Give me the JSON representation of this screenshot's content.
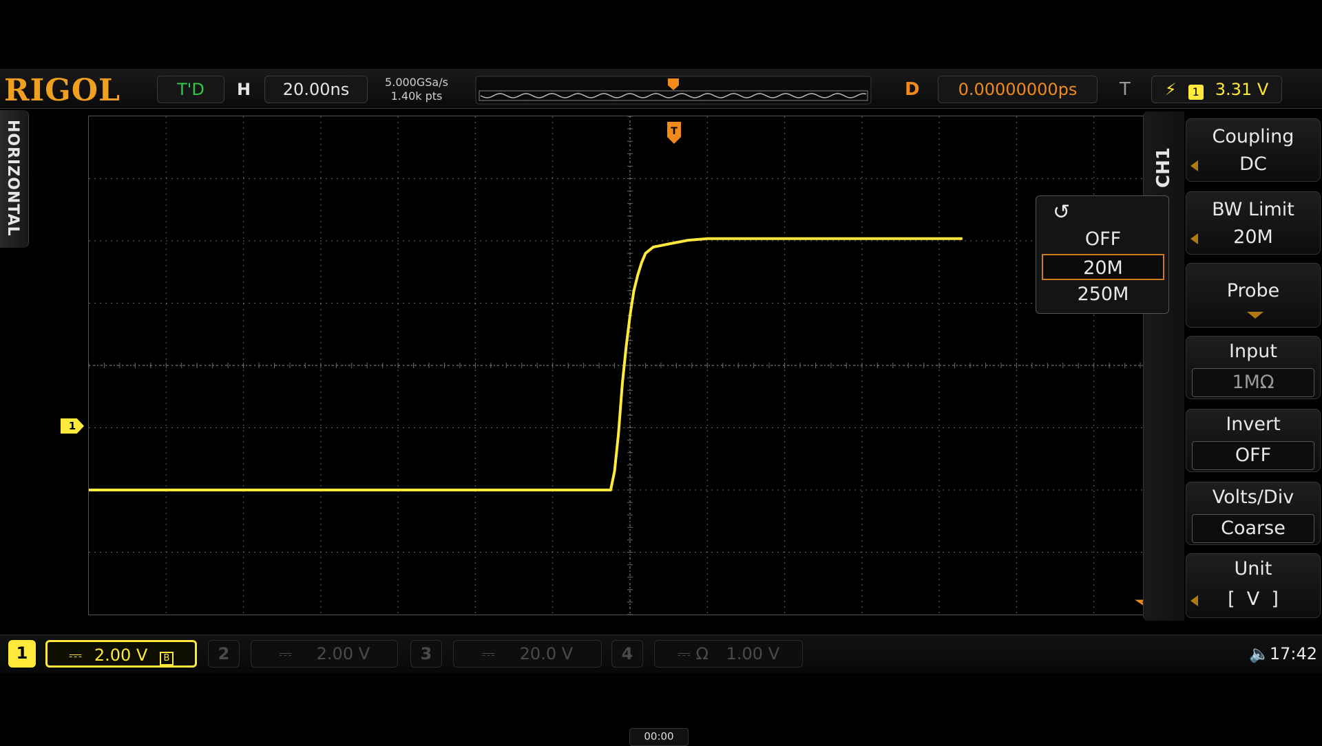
{
  "brand": "RIGOL",
  "status": {
    "trigger_status": "T'D",
    "horizontal_label": "H",
    "timebase": "20.00ns",
    "sample_rate": "5.000GSa/s",
    "memory_depth": "1.40k pts",
    "delay_label": "D",
    "delay_value": "0.00000000ps",
    "trigger_label": "T",
    "trigger_source": "1",
    "trigger_level": "3.31 V"
  },
  "side_tab": "HORIZONTAL",
  "channel_tab": "CH1",
  "menu": {
    "coupling": {
      "title": "Coupling",
      "value": "DC"
    },
    "bw_limit": {
      "title": "BW Limit",
      "value": "20M"
    },
    "probe": {
      "title": "Probe"
    },
    "input": {
      "title": "Input",
      "value": "1MΩ"
    },
    "invert": {
      "title": "Invert",
      "value": "OFF"
    },
    "volts_div": {
      "title": "Volts/Div",
      "value": "Coarse"
    },
    "unit": {
      "title": "Unit",
      "value": "[  V  ]"
    }
  },
  "bw_popup": {
    "options": [
      "OFF",
      "20M",
      "250M"
    ],
    "selected": "20M"
  },
  "channels": [
    {
      "num": "1",
      "coupling": "⎓",
      "scale": "2.00 V",
      "extra": "B",
      "active": true
    },
    {
      "num": "2",
      "coupling": "⎓",
      "scale": "2.00 V",
      "active": false
    },
    {
      "num": "3",
      "coupling": "⎓",
      "scale": "20.0 V",
      "active": false
    },
    {
      "num": "4",
      "coupling": "⎓ Ω",
      "scale": "1.00 V",
      "active": false
    }
  ],
  "channel1_marker": "1",
  "clock": "17:42",
  "video_time": "00:00",
  "colors": {
    "channel1": "#ffea3c",
    "accent_orange": "#f08a1a",
    "brand": "#f0a020",
    "grid": "#6a6a6a",
    "background": "#000000"
  },
  "chart_data": {
    "type": "line",
    "title": "",
    "xlabel": "",
    "ylabel": "",
    "x_units": "ns",
    "y_units": "V",
    "xlim": [
      -140,
      140
    ],
    "ylim": [
      -8,
      8
    ],
    "grid": true,
    "series": [
      {
        "x": [
          -140,
          -120,
          -100,
          -80,
          -60,
          -40,
          -20,
          -5,
          -4,
          -3,
          -2,
          -1,
          0,
          1,
          2,
          3,
          4,
          6,
          8,
          10,
          15,
          20,
          40,
          60,
          80,
          86
        ],
        "y": [
          -4.0,
          -4.0,
          -4.0,
          -4.0,
          -4.0,
          -4.0,
          -4.0,
          -4.0,
          -3.4,
          -2.2,
          -0.6,
          0.6,
          1.6,
          2.4,
          2.9,
          3.3,
          3.6,
          3.8,
          3.85,
          3.9,
          4.02,
          4.07,
          4.07,
          4.07,
          4.07,
          4.07
        ]
      }
    ]
  }
}
